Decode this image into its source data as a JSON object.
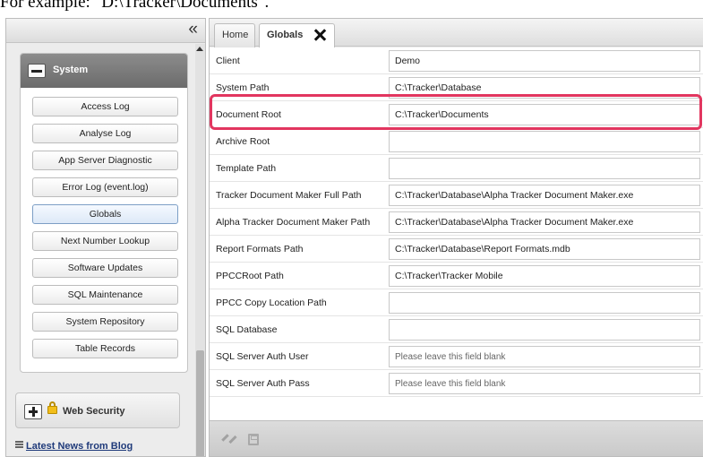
{
  "intro": {
    "text": "For example:  \"D:\\Tracker\\Documents\"."
  },
  "left": {
    "collapse_icon": "«",
    "system": {
      "title": "System",
      "items": [
        {
          "label": "Access Log"
        },
        {
          "label": "Analyse Log"
        },
        {
          "label": "App Server Diagnostic"
        },
        {
          "label": "Error Log (event.log)"
        },
        {
          "label": "Globals"
        },
        {
          "label": "Next Number Lookup"
        },
        {
          "label": "Software Updates"
        },
        {
          "label": "SQL Maintenance"
        },
        {
          "label": "System Repository"
        },
        {
          "label": "Table Records"
        }
      ],
      "active_item": "Globals"
    },
    "web_security": {
      "title": "Web Security"
    },
    "news_link": "Latest News from Blog"
  },
  "tabs": [
    {
      "label": "Home"
    },
    {
      "label": "Globals"
    }
  ],
  "form": {
    "rows": [
      {
        "label": "Client",
        "value": "Demo",
        "placeholder": ""
      },
      {
        "label": "System Path",
        "value": "C:\\Tracker\\Database",
        "placeholder": ""
      },
      {
        "label": "Document Root",
        "value": "C:\\Tracker\\Documents",
        "placeholder": ""
      },
      {
        "label": "Archive Root",
        "value": "",
        "placeholder": ""
      },
      {
        "label": "Template Path",
        "value": "",
        "placeholder": ""
      },
      {
        "label": "Tracker Document Maker Full Path",
        "value": "C:\\Tracker\\Database\\Alpha Tracker Document Maker.exe",
        "placeholder": ""
      },
      {
        "label": "Alpha Tracker Document Maker Path",
        "value": "C:\\Tracker\\Database\\Alpha Tracker Document Maker.exe",
        "placeholder": ""
      },
      {
        "label": "Report Formats Path",
        "value": "C:\\Tracker\\Database\\Report Formats.mdb",
        "placeholder": ""
      },
      {
        "label": "PPCCRoot Path",
        "value": "C:\\Tracker\\Tracker Mobile",
        "placeholder": ""
      },
      {
        "label": "PPCC Copy Location Path",
        "value": "",
        "placeholder": ""
      },
      {
        "label": "SQL Database",
        "value": "",
        "placeholder": ""
      },
      {
        "label": "SQL Server Auth User",
        "value": "",
        "placeholder": "Please leave this field blank"
      },
      {
        "label": "SQL Server Auth Pass",
        "value": "",
        "placeholder": "Please leave this field blank"
      }
    ],
    "highlighted_row": "Document Root"
  },
  "colors": {
    "highlight": "#e2365f",
    "active_nav": "#dde9f7",
    "system_header": "#7a7a7a"
  },
  "icons": [
    "chevrons-left-icon",
    "minus-icon",
    "plus-icon",
    "lock-icon",
    "close-icon",
    "news-icon",
    "clear-icon",
    "save-icon"
  ]
}
